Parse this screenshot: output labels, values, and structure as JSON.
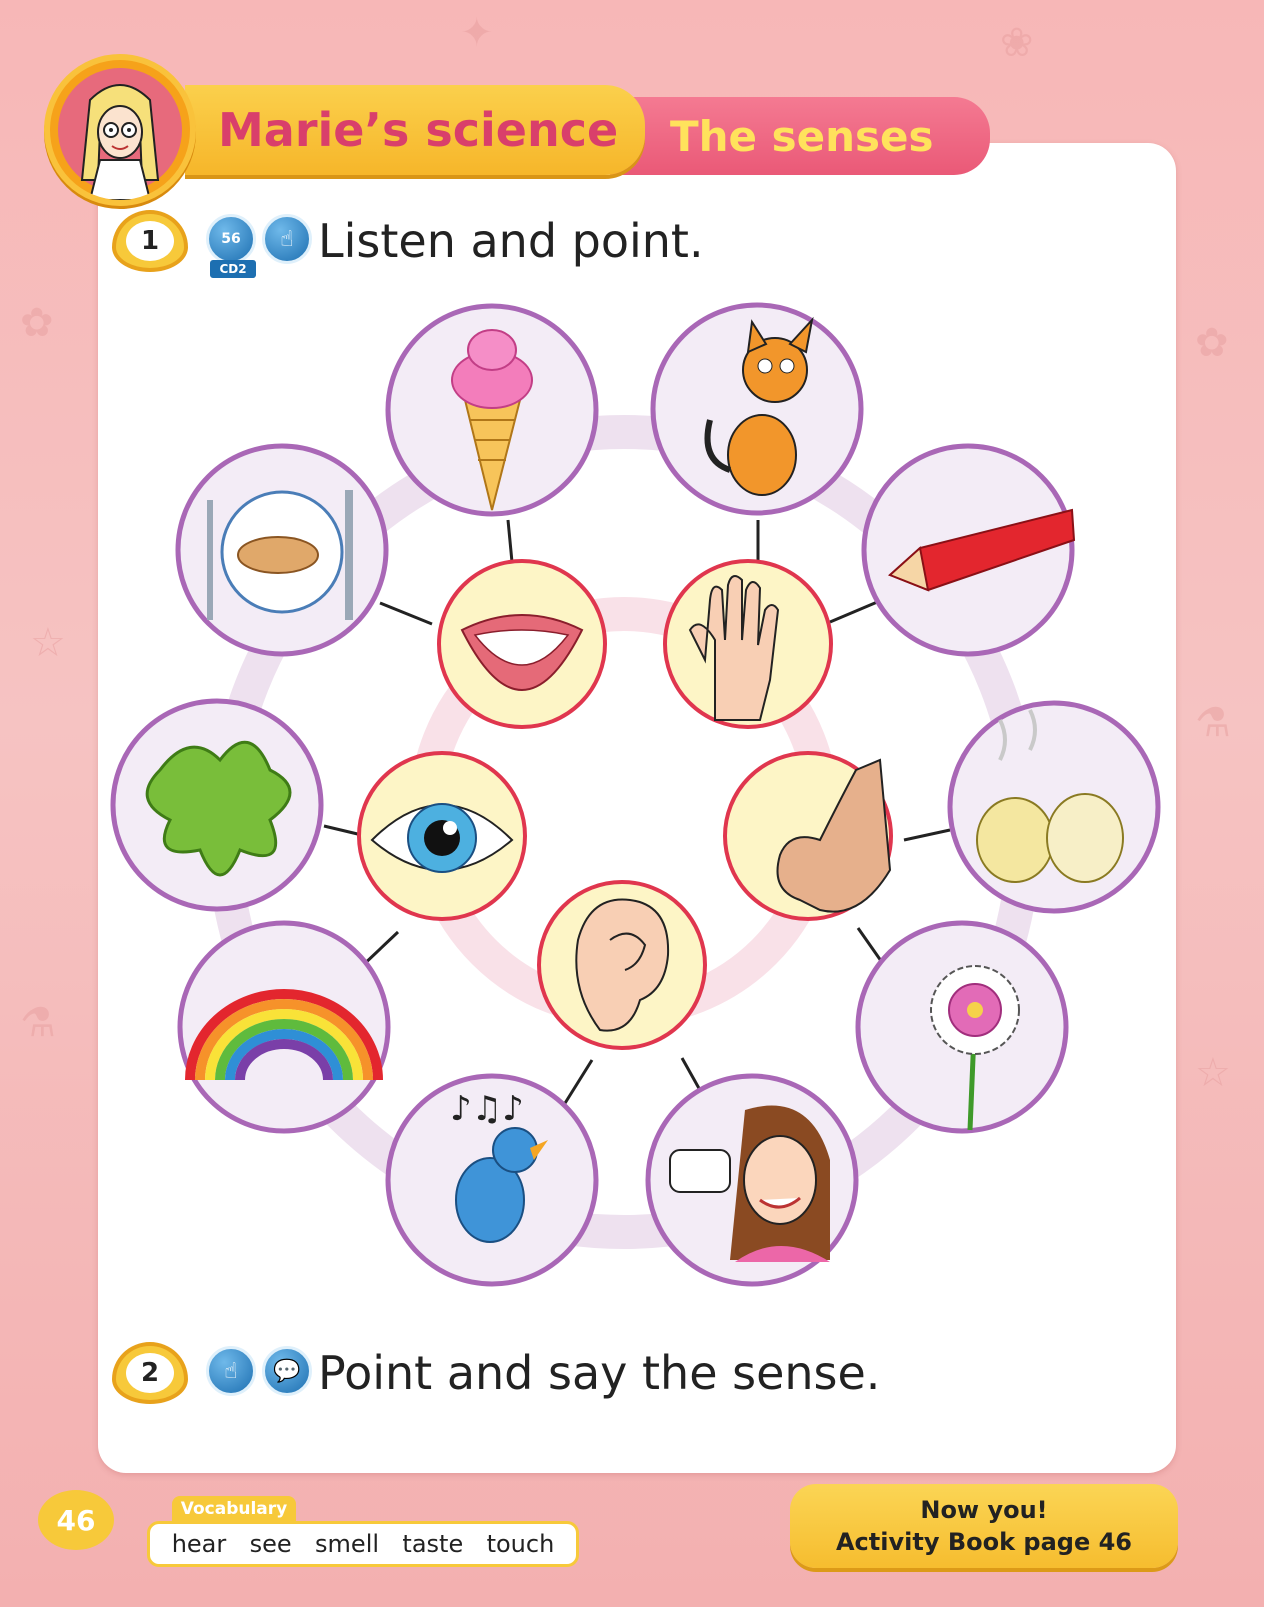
{
  "header": {
    "title": "Marie’s science",
    "topic": "The senses"
  },
  "activity1": {
    "number": "1",
    "cd_track": "56",
    "cd_label": "CD2",
    "instruction": "Listen and point."
  },
  "activity2": {
    "number": "2",
    "instruction": "Point and say the sense."
  },
  "diagram": {
    "senses": [
      "mouth",
      "hand",
      "eye",
      "nose",
      "ear"
    ],
    "items": [
      "ice-cream",
      "cat",
      "plate-of-fish",
      "pencil",
      "slime",
      "onions",
      "rainbow",
      "flower",
      "bird",
      "girl"
    ]
  },
  "footer": {
    "page_number": "46",
    "vocab_label": "Vocabulary",
    "vocab_words": [
      "hear",
      "see",
      "smell",
      "taste",
      "touch"
    ],
    "now_you_line1": "Now you!",
    "now_you_line2": "Activity Book page 46"
  },
  "colors": {
    "background": "#f7b7b7",
    "title_yellow": "#f6b62a",
    "title_text": "#d93f6b",
    "topic_pink": "#ea5977",
    "topic_text": "#ffe25c",
    "ring_purple": "#a967b6",
    "sense_border": "#e0364e"
  }
}
